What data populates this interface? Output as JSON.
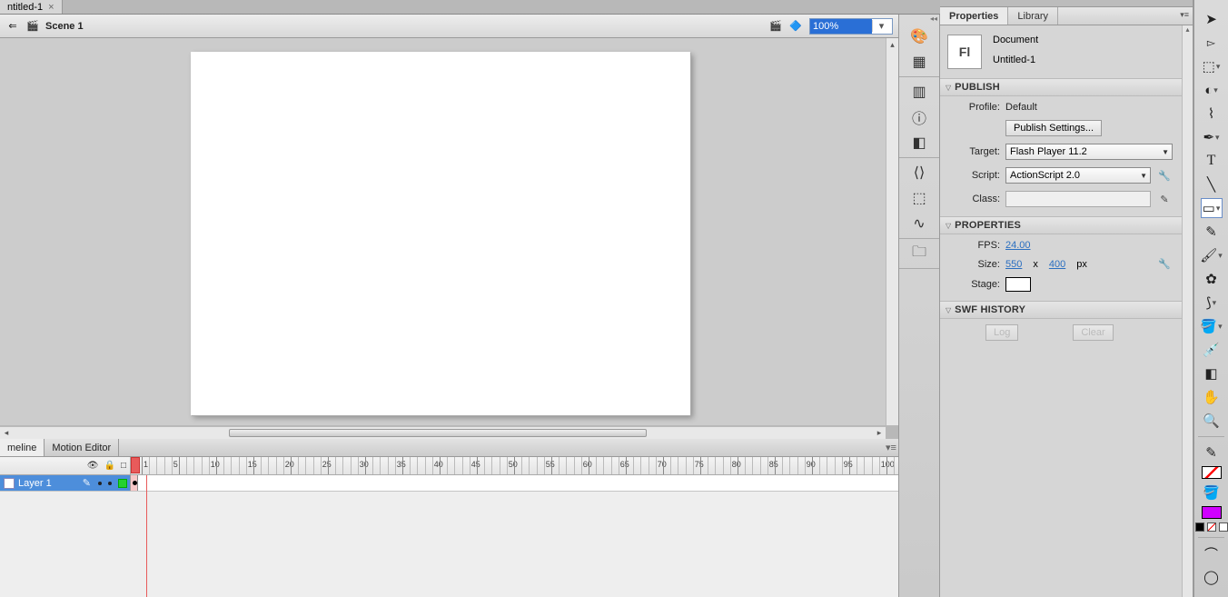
{
  "doc_tab": {
    "title": "ntitled-1",
    "close": "×"
  },
  "edit_bar": {
    "scene": "Scene 1",
    "zoom": "100%"
  },
  "timeline": {
    "tabs": [
      "meline",
      "Motion Editor"
    ],
    "layer_name": "Layer 1",
    "layer_icons": {
      "eye": "👁",
      "lock": "🔒",
      "outline": "□"
    },
    "ruler_marks": [
      1,
      5,
      10,
      15,
      20,
      25,
      30,
      35,
      40,
      45,
      50,
      55,
      60,
      65,
      70,
      75,
      80,
      85,
      90,
      95,
      100
    ]
  },
  "mid_icons_g1": [
    "palette",
    "swatches"
  ],
  "mid_icons_g2": [
    "align",
    "info",
    "transform"
  ],
  "mid_icons_g3": [
    "library-link",
    "component",
    "motion"
  ],
  "mid_icons_g4": [
    "project"
  ],
  "properties": {
    "tabs": [
      "Properties",
      "Library"
    ],
    "doc_type": "Document",
    "doc_name": "Untitled-1",
    "publish": {
      "title": "PUBLISH",
      "profile_label": "Profile:",
      "profile_value": "Default",
      "settings_btn": "Publish Settings...",
      "target_label": "Target:",
      "target_value": "Flash Player 11.2",
      "script_label": "Script:",
      "script_value": "ActionScript 2.0",
      "class_label": "Class:"
    },
    "props": {
      "title": "PROPERTIES",
      "fps_label": "FPS:",
      "fps_value": "24.00",
      "size_label": "Size:",
      "size_w": "550",
      "size_x": "x",
      "size_h": "400",
      "size_unit": "px",
      "stage_label": "Stage:"
    },
    "swf": {
      "title": "SWF HISTORY",
      "log": "Log",
      "clear": "Clear"
    }
  },
  "tool_names": [
    "selection",
    "subselection",
    "free-transform",
    "3d-rotation",
    "lasso",
    "pen",
    "text",
    "line",
    "rectangle",
    "pencil",
    "brush",
    "deco",
    "bone",
    "paint-bucket",
    "eyedropper",
    "eraser",
    "hand",
    "zoom"
  ]
}
